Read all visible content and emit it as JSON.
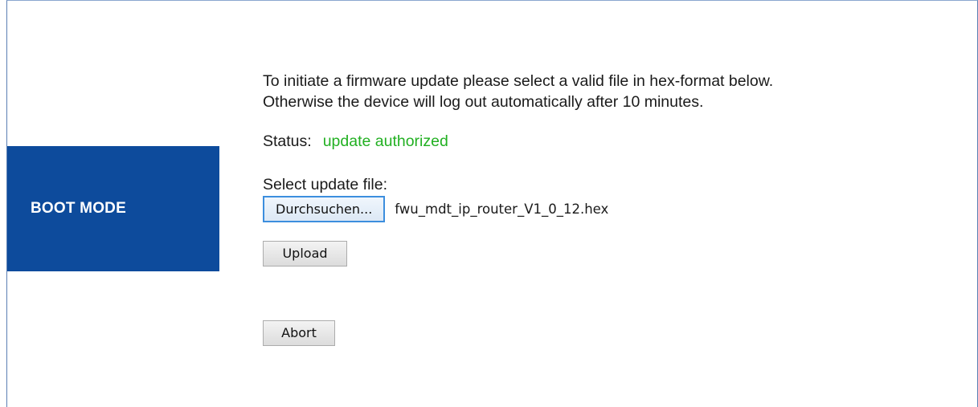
{
  "sidebar": {
    "label": "BOOT MODE"
  },
  "intro": {
    "line1": "To initiate a firmware update please select a valid file in hex-format below.",
    "line2": "Otherwise the device will log out automatically after 10 minutes."
  },
  "status": {
    "label": "Status:",
    "value": "update authorized",
    "value_color": "#22b022"
  },
  "file_select": {
    "label": "Select update file:",
    "browse_label": "Durchsuchen...",
    "file_name": "fwu_mdt_ip_router_V1_0_12.hex"
  },
  "actions": {
    "upload_label": "Upload",
    "abort_label": "Abort"
  },
  "colors": {
    "sidebar_bg": "#0d4b9c",
    "frame_border": "#5b7fb3"
  }
}
